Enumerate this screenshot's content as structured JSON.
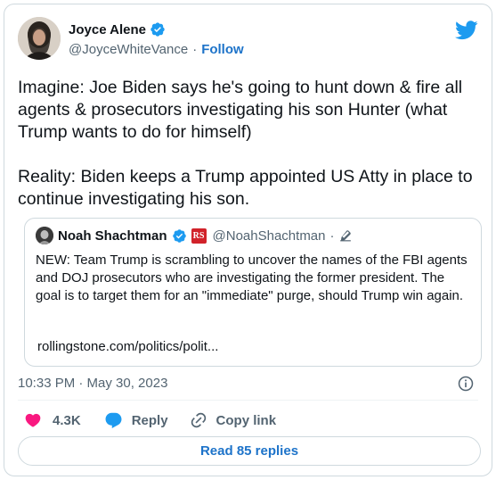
{
  "author": {
    "display_name": "Joyce Alene",
    "handle": "@JoyceWhiteVance",
    "separator": "·",
    "follow_label": "Follow"
  },
  "tweet": {
    "text": "Imagine: Joe Biden says he's going to hunt down & fire all agents & prosecutors investigating his son Hunter (what Trump wants to do for himself)\n\nReality: Biden keeps a Trump appointed US Atty in place to continue investigating his son."
  },
  "quoted_tweet": {
    "display_name": "Noah Shachtman",
    "badge_text": "RS",
    "handle": "@NoahShachtman",
    "separator": "·",
    "text": "NEW: Team Trump is scrambling to uncover the names of the FBI agents and DOJ prosecutors who are investigating the former president. The goal is to target them for an \"immediate\" purge, should Trump win again.",
    "link": "rollingstone.com/politics/polit..."
  },
  "meta": {
    "timestamp": "10:33 PM · May 30, 2023"
  },
  "actions": {
    "like_count": "4.3K",
    "reply_label": "Reply",
    "copy_link_label": "Copy link"
  },
  "footer": {
    "read_replies_label": "Read 85 replies"
  },
  "icons": {
    "brand": "twitter-bird-icon",
    "verified": "verified-badge-icon",
    "like": "heart-icon",
    "reply": "speech-bubble-icon",
    "copy": "link-icon",
    "info": "info-icon",
    "edit": "pencil-icon"
  },
  "colors": {
    "twitter_blue": "#1d9bf0",
    "link_blue": "#1d73c9",
    "like_pink": "#f91880",
    "muted": "#536471",
    "border": "#cfd9de",
    "rs_red": "#d1222a"
  }
}
